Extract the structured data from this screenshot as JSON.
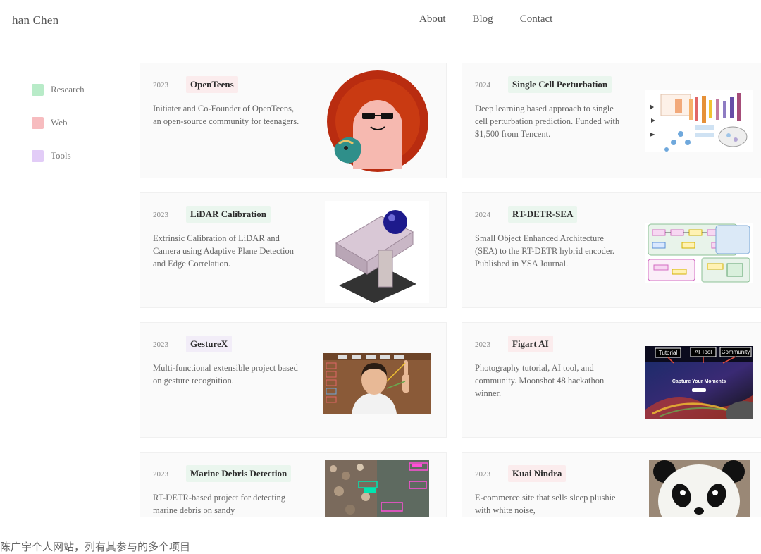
{
  "header": {
    "site_name": "han Chen",
    "nav": {
      "about": "About",
      "blog": "Blog",
      "contact": "Contact"
    }
  },
  "legend": [
    {
      "label": "Research",
      "color": "#b8ebc8"
    },
    {
      "label": "Web",
      "color": "#f7bcbf"
    },
    {
      "label": "Tools",
      "color": "#e2ccf7"
    }
  ],
  "projects": [
    {
      "year": "2023",
      "title": "OpenTeens",
      "category": "web",
      "desc": "Initiater and Co-Founder of OpenTeens, an open-source community for teenagers.",
      "thumb": "logo-icon"
    },
    {
      "year": "2024",
      "title": "Single Cell Perturbation",
      "category": "research",
      "desc": "Deep learning based approach to single cell perturbation prediction. Funded with $1,500 from Tencent.",
      "thumb": "diagram-icon"
    },
    {
      "year": "2023",
      "title": "LiDAR Calibration",
      "category": "research",
      "desc": "Extrinsic Calibration of LiDAR and Camera using Adaptive Plane Detection and Edge Correlation.",
      "thumb": "device-icon"
    },
    {
      "year": "2024",
      "title": "RT-DETR-SEA",
      "category": "research",
      "desc": "Small Object Enhanced Architecture (SEA) to the RT-DETR hybrid encoder. Published in YSA Journal.",
      "thumb": "architecture-diagram-icon"
    },
    {
      "year": "2023",
      "title": "GestureX",
      "category": "tools",
      "desc": "Multi-functional extensible project based on gesture recognition.",
      "thumb": "gesture-photo-icon"
    },
    {
      "year": "2023",
      "title": "Figart AI",
      "category": "web",
      "desc": "Photography tutorial, AI tool, and community. Moonshot 48 hackathon winner.",
      "thumb": "website-screenshot-icon",
      "thumb_labels": [
        "Tutorial",
        "AI Tool",
        "Community"
      ],
      "thumb_heading": "Capture Your Moments"
    },
    {
      "year": "2023",
      "title": "Marine Debris Detection",
      "category": "research",
      "desc": "RT-DETR-based project for detecting marine debris on sandy",
      "thumb": "detection-photo-icon"
    },
    {
      "year": "2023",
      "title": "Kuai Nindra",
      "category": "web",
      "desc": "E-commerce site that sells sleep plushie with white noise,",
      "thumb": "panda-plushie-icon"
    }
  ],
  "caption": "陈广宇个人网站，列有其参与的多个项目"
}
